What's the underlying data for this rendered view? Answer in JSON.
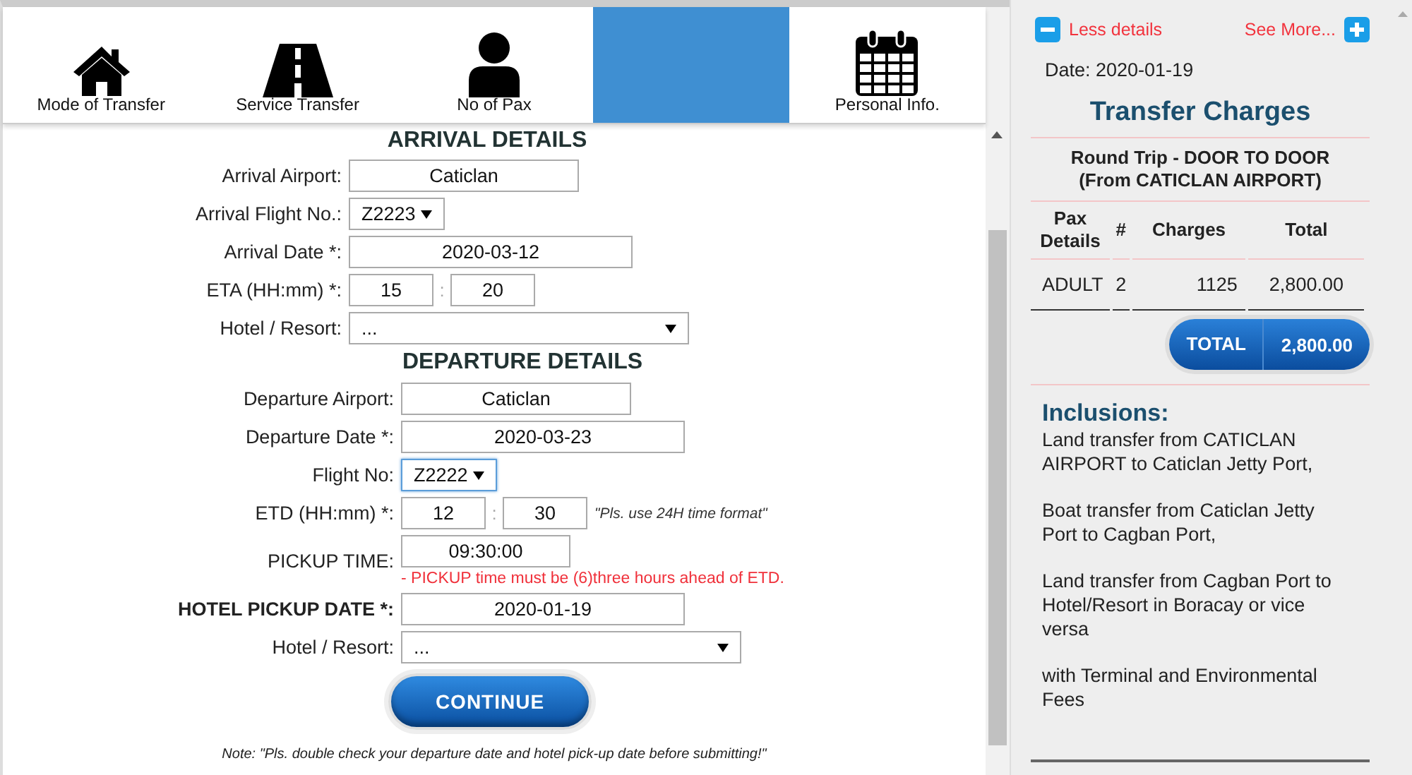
{
  "steps": [
    {
      "label": "Mode of Transfer",
      "selected": false
    },
    {
      "label": "Service Transfer",
      "selected": false
    },
    {
      "label": "No of Pax",
      "selected": false
    },
    {
      "selected": true
    },
    {
      "label": "Personal Info.",
      "selected": false
    }
  ],
  "sections": [
    {
      "title": "ARRIVAL DETAILS",
      "fields": [
        {
          "kind": "airport",
          "label": "Arrival Airport:",
          "value": "Caticlan"
        },
        {
          "kind": "flight",
          "label": "Arrival Flight No.:",
          "value": "Z2223",
          "focused": false
        },
        {
          "kind": "date",
          "label": "Arrival Date *:",
          "value": "2020-03-12"
        },
        {
          "kind": "time",
          "label": "ETA (HH:mm) *:",
          "hours": "15",
          "separator": ":",
          "minutes": "20"
        },
        {
          "kind": "hotel",
          "label": "Hotel / Resort:",
          "value": "..."
        }
      ]
    },
    {
      "title": "DEPARTURE DETAILS",
      "fields": [
        {
          "kind": "airport",
          "label": "Departure Airport:",
          "value": "Caticlan"
        },
        {
          "kind": "date",
          "label": "Departure Date *:",
          "value": "2020-03-23"
        },
        {
          "kind": "flight",
          "label": "Flight No:",
          "value": "Z2222",
          "focused": true
        },
        {
          "kind": "time",
          "label": "ETD (HH:mm) *:",
          "hours": "12",
          "separator": ":",
          "minutes": "30",
          "hint": "\"Pls. use 24H time format\""
        },
        {
          "kind": "clock",
          "label": "PICKUP TIME:",
          "value": "09:30:00",
          "error": "- PICKUP time must be (6)three hours ahead of ETD."
        },
        {
          "kind": "date",
          "label": "HOTEL PICKUP DATE *:",
          "value": "2020-01-19",
          "bold": true
        },
        {
          "kind": "hotel",
          "label": "Hotel / Resort:",
          "value": "..."
        }
      ]
    }
  ],
  "continue_button": "CONTINUE",
  "note": "Note: \"Pls. double check your departure date and hotel pick-up date before submitting!\"",
  "summary": {
    "less_link": "Less details",
    "more_link": "See More...",
    "date": "Date: 2020-01-19",
    "title": "Transfer Charges",
    "trip": [
      "Round Trip - DOOR TO DOOR",
      "(From CATICLAN AIRPORT)"
    ],
    "columns": [
      "Pax Details",
      "#",
      "Charges",
      "Total"
    ],
    "rows": [
      [
        "ADULT",
        "2",
        "1125",
        "2,800.00"
      ]
    ],
    "total_label": "TOTAL",
    "total_value": "2,800.00",
    "inclusions_title": "Inclusions:",
    "inclusions": [
      "Land transfer from CATICLAN AIRPORT to Caticlan Jetty Port,",
      "Boat transfer from Caticlan Jetty Port to Cagban Port,",
      "Land transfer from Cagban Port to Hotel/Resort in Boracay or vice versa",
      "with Terminal and Environmental Fees"
    ]
  }
}
